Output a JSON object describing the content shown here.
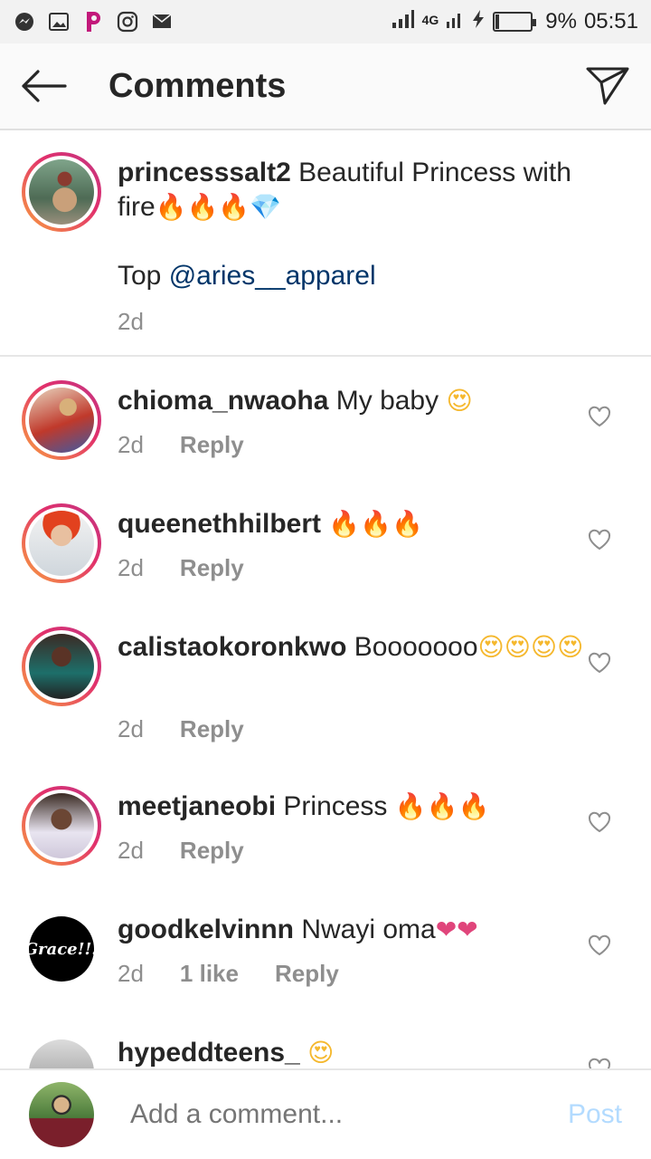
{
  "status_bar": {
    "network": "4G",
    "battery_pct": "9%",
    "battery_level": 0.09,
    "time": "05:51",
    "icons": [
      "messenger-icon",
      "gallery-icon",
      "picsart-icon",
      "instagram-icon",
      "mail-icon"
    ]
  },
  "header": {
    "title": "Comments"
  },
  "caption": {
    "username": "princesssalt2",
    "text": " Beautiful Princess with fire",
    "emojis": "🔥🔥🔥💎",
    "line2_prefix": "Top ",
    "mention": "@aries__apparel",
    "time": "2d"
  },
  "comments": [
    {
      "username": "chioma_nwaoha",
      "text": " My baby ",
      "emojis": "😍",
      "emoji_kind": "heart-eyes",
      "time": "2d",
      "likes": "",
      "reply": "Reply"
    },
    {
      "username": "queenethhilbert",
      "text": " ",
      "emojis": "🔥🔥🔥",
      "emoji_kind": "fire",
      "time": "2d",
      "likes": "",
      "reply": "Reply"
    },
    {
      "username": "calistaokoronkwo",
      "text": " Booooooo",
      "emojis": "😍😍😍😍",
      "emoji_kind": "heart-eyes",
      "time": "2d",
      "likes": "",
      "reply": "Reply"
    },
    {
      "username": "meetjaneobi",
      "text": " Princess ",
      "emojis": "🔥🔥🔥",
      "emoji_kind": "fire",
      "time": "2d",
      "likes": "",
      "reply": "Reply"
    },
    {
      "username": "goodkelvinnn",
      "text": " Nwayi oma",
      "emojis": "❤❤",
      "emoji_kind": "pink-heart",
      "time": "2d",
      "likes": "1 like",
      "reply": "Reply"
    },
    {
      "username": "hypeddteens_",
      "text": " ",
      "emojis": "😍",
      "emoji_kind": "heart-eyes",
      "time": "",
      "likes": "",
      "reply": ""
    }
  ],
  "composer": {
    "placeholder": "Add a comment...",
    "post_label": "Post"
  },
  "colors": {
    "accent_link": "#003569",
    "post_disabled": "#b3dbff",
    "story_ring_start": "#f9a03f",
    "story_ring_end": "#c13584"
  }
}
